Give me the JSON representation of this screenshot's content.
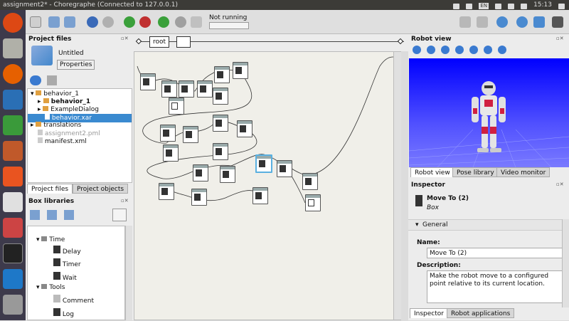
{
  "window": {
    "title": "assignment2* - Choregraphe (Connected to 127.0.0.1)",
    "clock": "15:13",
    "tray_badge": "EN"
  },
  "toolbar": {
    "status_text": "Not running"
  },
  "breadcrumb": {
    "root_label": "root"
  },
  "project_files": {
    "header": "Project files",
    "project_name": "Untitled",
    "properties_button": "Properties",
    "tree": [
      "behavior_1",
      "behavior_1",
      "ExampleDialog",
      "behavior.xar",
      "translations",
      "assignment2.pml",
      "manifest.xml"
    ],
    "tabs": [
      "Project files",
      "Project objects"
    ]
  },
  "box_libraries": {
    "header": "Box libraries",
    "tree": [
      "Time",
      "Delay",
      "Timer",
      "Wait",
      "Tools",
      "Comment",
      "Log"
    ]
  },
  "robot_view": {
    "header": "Robot view",
    "tabs": [
      "Robot view",
      "Pose library",
      "Video monitor"
    ]
  },
  "inspector": {
    "header": "Inspector",
    "box_name": "Move To (2)",
    "box_type": "Box",
    "section": "General",
    "name_label": "Name:",
    "name_value": "Move To (2)",
    "description_label": "Description:",
    "description_value": "Make the robot move to a configured point relative to its current location.",
    "tabs": [
      "Inspector",
      "Robot applications"
    ]
  },
  "canvas": {
    "node_icon": "walking-figure-icon",
    "node_count": 22
  }
}
